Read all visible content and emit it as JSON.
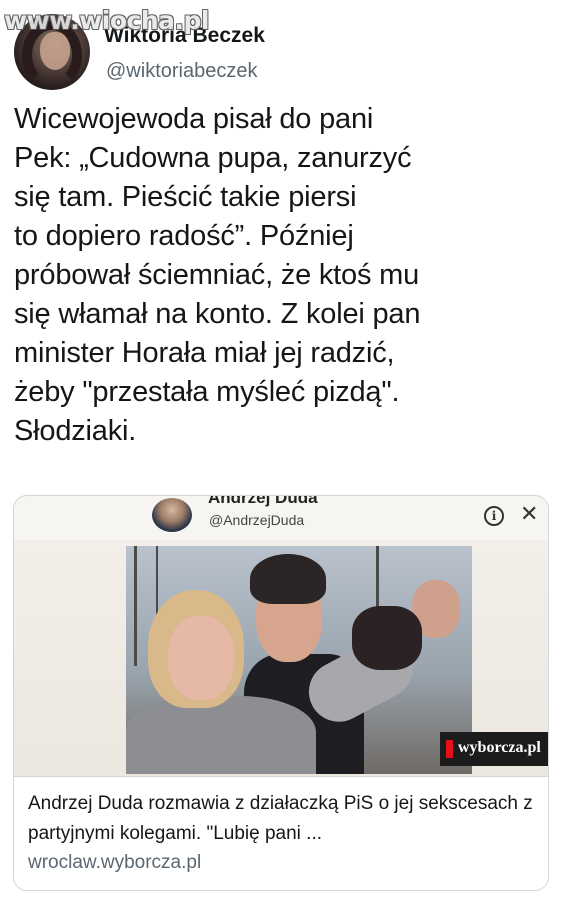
{
  "watermark": {
    "text": "www.wiocha.pl"
  },
  "tweet": {
    "display_name": "Wiktoria Beczek",
    "handle": "@wiktoriabeczek",
    "text": "Wicewojewoda pisał do pani\nPek: „Cudowna pupa, zanurzyć\nsię tam. Pieścić takie piersi\nto dopiero radość”. Później\npróbował ściemniać, że ktoś mu\nsię włamał na konto. Z kolei pan\nminister Horała miał jej radzić,\nżeby \"przestała myśleć pizdą\".\nSłodziaki."
  },
  "card": {
    "embed": {
      "name": "Andrzej Duda",
      "handle": "@AndrzejDuda",
      "info_icon": "info-icon",
      "close_icon": "close-icon",
      "info_glyph": "i",
      "close_glyph": "✕"
    },
    "photo_badge": "wyborcza.pl",
    "title": "Andrzej Duda rozmawia z działaczką PiS o jej sekscesach z partyjnymi kolegami. \"Lubię pani ...",
    "domain": "wroclaw.wyborcza.pl"
  },
  "colors": {
    "text": "#14171a",
    "secondary": "#5b6670",
    "border": "#cfd6dc",
    "badge_red": "#e4101c"
  }
}
